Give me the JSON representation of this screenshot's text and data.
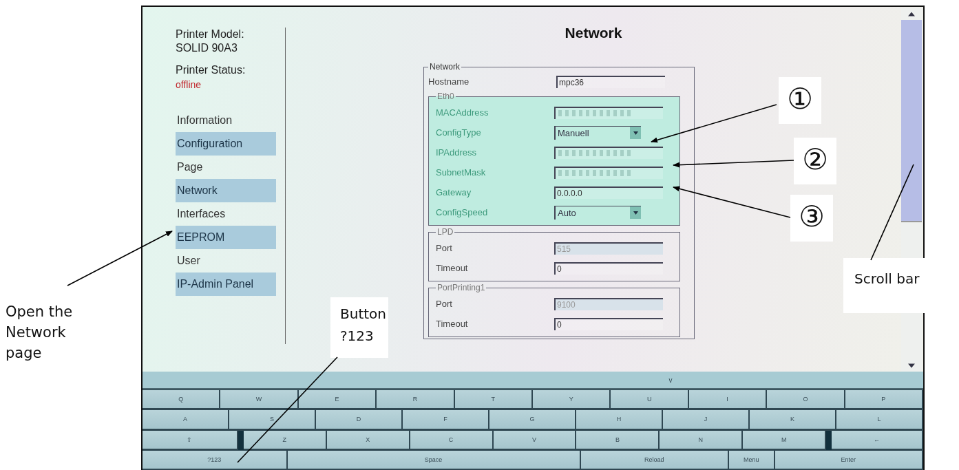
{
  "sidebar": {
    "model_label": "Printer Model:",
    "model": "SOLID 90A3",
    "status_label": "Printer Status:",
    "status": "offline",
    "items": [
      {
        "label": "Information",
        "shaded": false
      },
      {
        "label": "Configuration",
        "shaded": true
      },
      {
        "label": "Page",
        "shaded": false
      },
      {
        "label": "Network",
        "shaded": true
      },
      {
        "label": "Interfaces",
        "shaded": false
      },
      {
        "label": "EEPROM",
        "shaded": true
      },
      {
        "label": "User",
        "shaded": false
      },
      {
        "label": "IP-Admin Panel",
        "shaded": true
      }
    ]
  },
  "page_title": "Network",
  "form": {
    "legend": "Network",
    "fields": [
      {
        "label": "Hostname",
        "kind": "text",
        "value": "mpc36"
      }
    ],
    "groups": [
      {
        "legend": "Eth0",
        "tinted": true,
        "fields": [
          {
            "label": "MACAddress",
            "kind": "text",
            "blurred": true
          },
          {
            "label": "ConfigType",
            "kind": "select",
            "value": "Manuell"
          },
          {
            "label": "IPAddress",
            "kind": "text",
            "blurred": true
          },
          {
            "label": "SubnetMask",
            "kind": "text",
            "blurred": true
          },
          {
            "label": "Gateway",
            "kind": "text",
            "value": "0.0.0.0"
          },
          {
            "label": "ConfigSpeed",
            "kind": "select",
            "value": "Auto"
          }
        ]
      },
      {
        "legend": "LPD",
        "tinted": false,
        "fields": [
          {
            "label": "Port",
            "kind": "text",
            "value": "515",
            "disabled": true
          },
          {
            "label": "Timeout",
            "kind": "text",
            "value": "0"
          }
        ]
      },
      {
        "legend": "PortPrinting1",
        "tinted": false,
        "fields": [
          {
            "label": "Port",
            "kind": "text",
            "value": "9100",
            "disabled": true
          },
          {
            "label": "Timeout",
            "kind": "text",
            "value": "0"
          }
        ]
      }
    ]
  },
  "keyboard": {
    "collapse": "v",
    "rows": [
      [
        {
          "label": "Q",
          "kind": "letter"
        },
        {
          "label": "W",
          "kind": "letter"
        },
        {
          "label": "E",
          "kind": "letter"
        },
        {
          "label": "R",
          "kind": "letter"
        },
        {
          "label": "T",
          "kind": "letter"
        },
        {
          "label": "Y",
          "kind": "letter"
        },
        {
          "label": "U",
          "kind": "letter"
        },
        {
          "label": "I",
          "kind": "letter"
        },
        {
          "label": "O",
          "kind": "letter"
        },
        {
          "label": "P",
          "kind": "letter"
        }
      ],
      [
        {
          "label": "A",
          "kind": "letter"
        },
        {
          "label": "S",
          "kind": "letter"
        },
        {
          "label": "D",
          "kind": "letter"
        },
        {
          "label": "F",
          "kind": "letter"
        },
        {
          "label": "G",
          "kind": "letter"
        },
        {
          "label": "H",
          "kind": "letter"
        },
        {
          "label": "J",
          "kind": "letter"
        },
        {
          "label": "K",
          "kind": "letter"
        },
        {
          "label": "L",
          "kind": "letter"
        }
      ],
      [
        {
          "label": "⇧",
          "kind": "shift"
        },
        {
          "label": "Z",
          "kind": "letter"
        },
        {
          "label": "X",
          "kind": "letter"
        },
        {
          "label": "C",
          "kind": "letter"
        },
        {
          "label": "V",
          "kind": "letter"
        },
        {
          "label": "B",
          "kind": "letter"
        },
        {
          "label": "N",
          "kind": "letter"
        },
        {
          "label": "M",
          "kind": "letter"
        },
        {
          "label": "←",
          "kind": "backspace"
        }
      ],
      [
        {
          "label": "?123",
          "kind": "symbols"
        },
        {
          "label": "Space",
          "kind": "space"
        },
        {
          "label": "Reload",
          "kind": "reload"
        },
        {
          "label": "Menu",
          "kind": "menu"
        },
        {
          "label": "Enter",
          "kind": "enter"
        }
      ]
    ]
  },
  "annotations": {
    "open_page": "Open the Network page",
    "button_note": "Button ?123",
    "marker_1": "①",
    "marker_2": "②",
    "marker_3": "③",
    "scroll_note": "Scroll bar"
  }
}
